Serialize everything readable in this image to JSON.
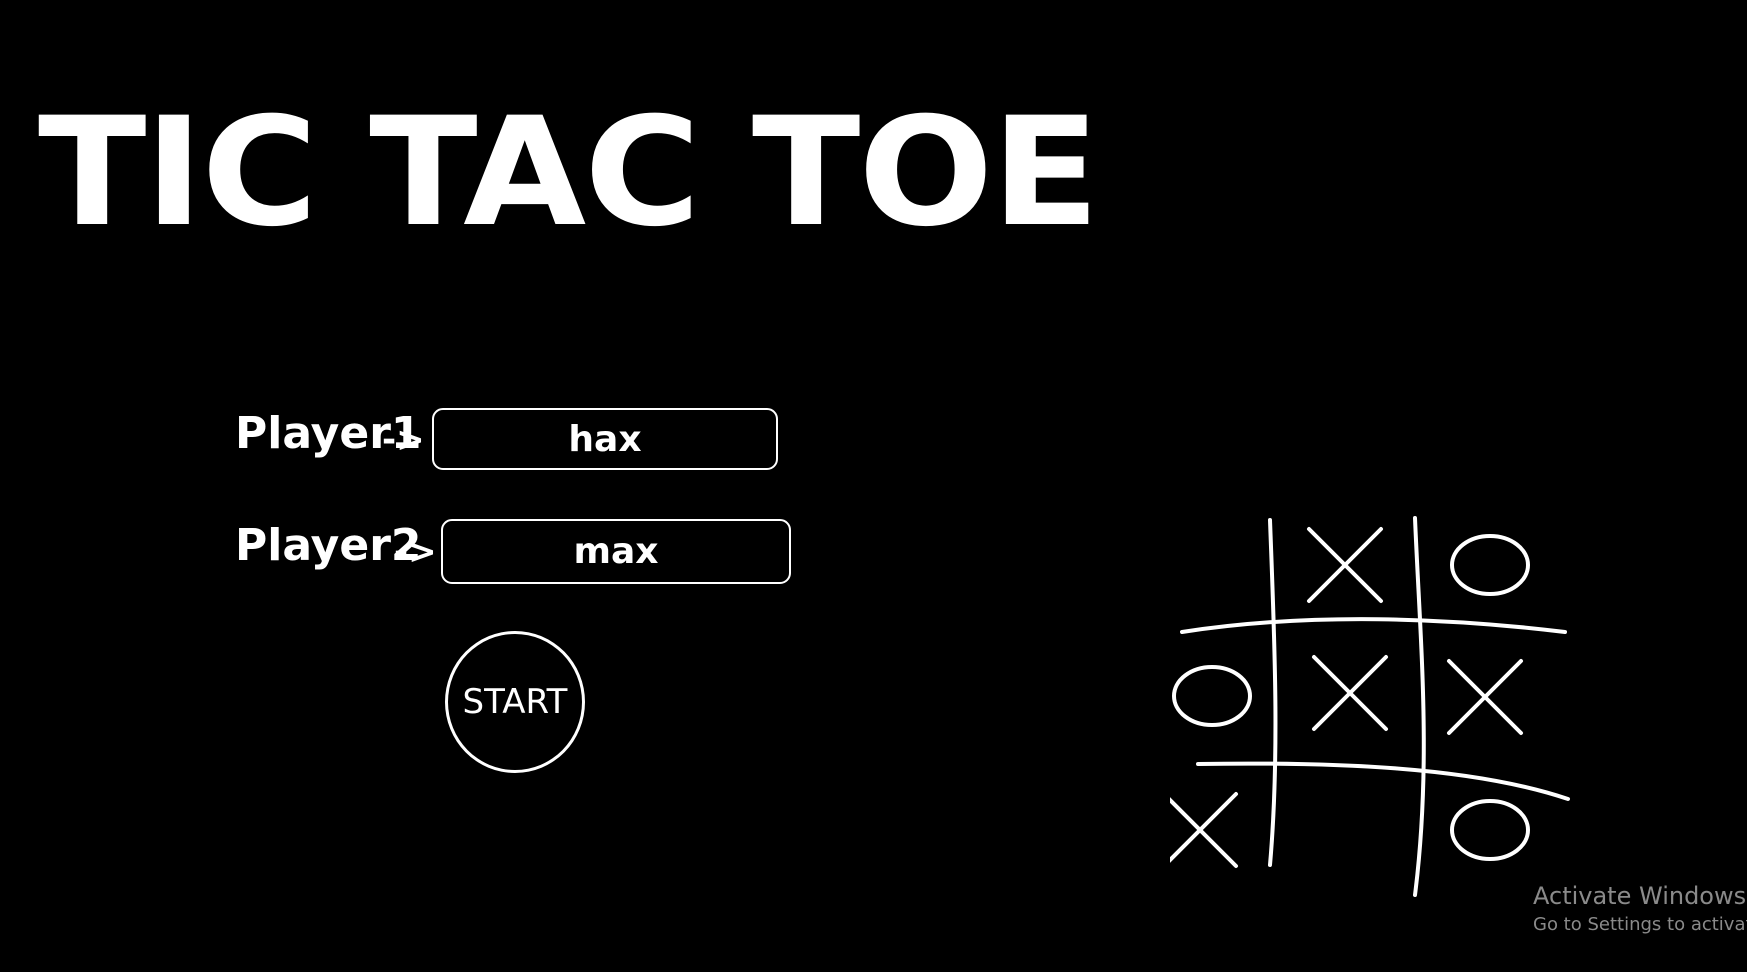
{
  "title": "TIC TAC TOE",
  "players": [
    {
      "label": "Player1",
      "arrow": "->",
      "value": "hax"
    },
    {
      "label": "Player2",
      "arrow": "->",
      "value": "max"
    }
  ],
  "start_label": "START",
  "board": {
    "cells": [
      "",
      "X",
      "O",
      "O",
      "X",
      "X",
      "X",
      "",
      "O"
    ]
  },
  "watermark": {
    "title": "Activate Windows",
    "subtitle": "Go to Settings to activate W"
  },
  "colors": {
    "background": "#000000",
    "foreground": "#ffffff",
    "watermark": "#8a8a8a"
  }
}
